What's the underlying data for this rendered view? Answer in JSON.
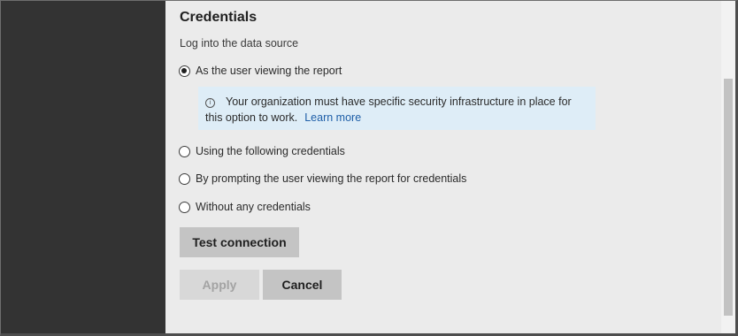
{
  "credentials": {
    "heading": "Credentials",
    "subtitle": "Log into the data source",
    "options": [
      {
        "label": "As the user viewing the report",
        "checked": true
      },
      {
        "label": "Using the following credentials",
        "checked": false
      },
      {
        "label": "By prompting the user viewing the report for credentials",
        "checked": false
      },
      {
        "label": "Without any credentials",
        "checked": false
      }
    ],
    "info": {
      "icon": "info-icon",
      "text_line1": "Your organization must have specific security infrastructure in place for",
      "text_line2": "this option to work.",
      "link_label": "Learn more"
    }
  },
  "buttons": {
    "test_connection": "Test connection",
    "apply": "Apply",
    "cancel": "Cancel"
  }
}
